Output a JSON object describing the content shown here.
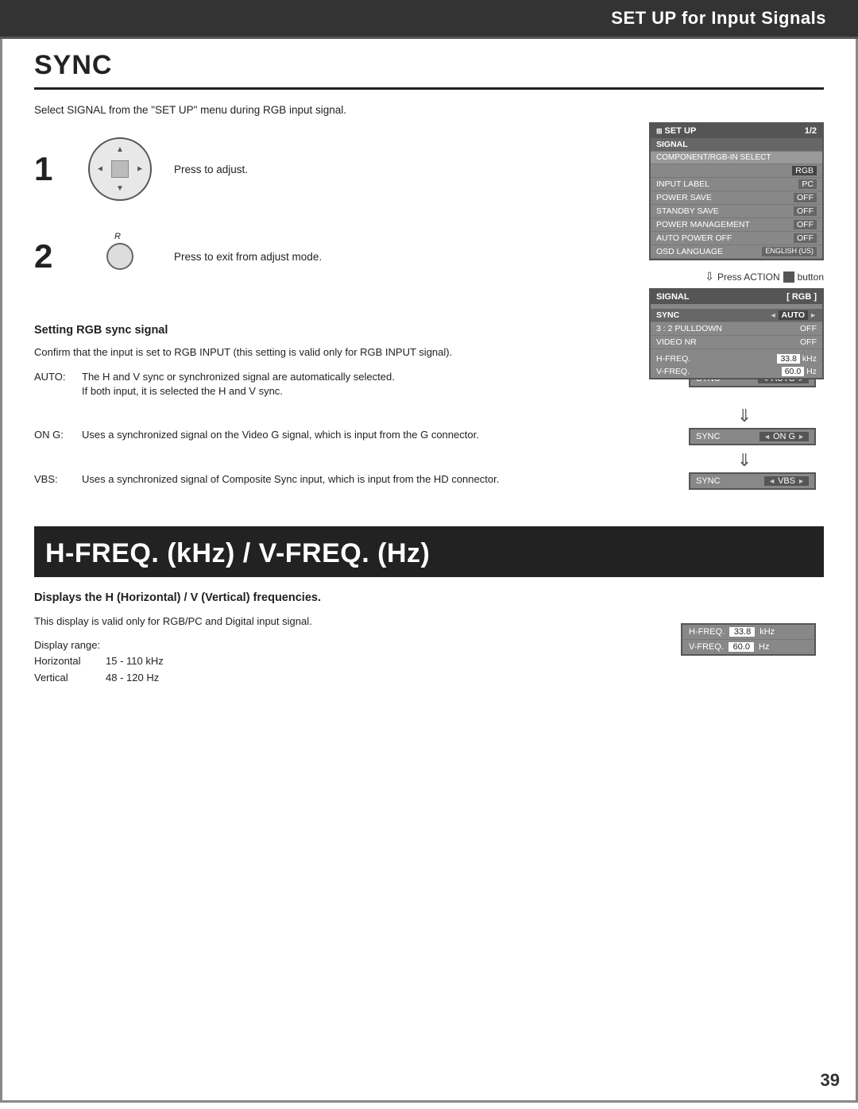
{
  "header": {
    "title": "SET UP for Input Signals"
  },
  "sync_section": {
    "title": "SYNC",
    "intro": "Select SIGNAL from the \"SET UP\" menu during RGB input signal.",
    "step1": {
      "number": "1",
      "text": "Press to adjust."
    },
    "step2": {
      "number": "2",
      "label": "R",
      "text": "Press to exit from adjust mode."
    },
    "press_action": "Press ACTION",
    "button_symbol": "■",
    "button_word": "button",
    "osd_setup": {
      "header_left": "SET UP",
      "header_right": "1/2",
      "rows": [
        {
          "label": "SIGNAL",
          "value": ""
        },
        {
          "label": "COMPONENT/RGB-IN SELECT",
          "value": ""
        },
        {
          "label": "",
          "value": "RGB"
        },
        {
          "label": "INPUT LABEL",
          "value": "PC"
        },
        {
          "label": "POWER SAVE",
          "value": "OFF"
        },
        {
          "label": "STANDBY SAVE",
          "value": "OFF"
        },
        {
          "label": "POWER MANAGEMENT",
          "value": "OFF"
        },
        {
          "label": "AUTO POWER OFF",
          "value": "OFF"
        },
        {
          "label": "OSD LANGUAGE",
          "value": "ENGLISH (US)"
        }
      ]
    },
    "osd_signal": {
      "header_left": "SIGNAL",
      "header_right": "[ RGB ]",
      "rows": [
        {
          "label": "SYNC",
          "value": "AUTO",
          "arrows": true
        },
        {
          "label": "3 : 2 PULLDOWN",
          "value": "OFF"
        },
        {
          "label": "VIDEO NR",
          "value": "OFF"
        }
      ],
      "freq_rows": [
        {
          "label": "H-FREQ.",
          "value": "33.8",
          "unit": "kHz"
        },
        {
          "label": "V-FREQ.",
          "value": "60.0",
          "unit": "Hz"
        }
      ]
    },
    "rgb_sync_subtitle": "Setting RGB sync signal",
    "rgb_sync_intro": "Confirm that the input is set to RGB INPUT (this setting is valid only for RGB INPUT signal).",
    "definitions": [
      {
        "term": "AUTO:",
        "desc": "The H and V sync or synchronized signal are automatically selected. If both input, it is selected the H and V sync."
      },
      {
        "term": "ON G:",
        "desc": "Uses a synchronized signal on the Video G signal, which is input from the G connector."
      },
      {
        "term": "VBS:",
        "desc": "Uses a synchronized signal of Composite Sync input, which is input from the HD connector."
      }
    ],
    "sync_panels": [
      {
        "label": "SYNC",
        "value": "AUTO"
      },
      {
        "label": "SYNC",
        "value": "ON G"
      },
      {
        "label": "SYNC",
        "value": "VBS"
      }
    ]
  },
  "hfreq_section": {
    "title": "H-FREQ. (kHz) / V-FREQ. (Hz)",
    "subtitle": "Displays the H (Horizontal) / V (Vertical) frequencies.",
    "text1": "This display is valid only for RGB/PC and Digital input signal.",
    "text2": "Display range:",
    "ranges": [
      {
        "label": "Horizontal",
        "value": "15 - 110 kHz"
      },
      {
        "label": "Vertical",
        "value": "48 - 120 Hz"
      }
    ],
    "freq_panel": [
      {
        "label": "H-FREQ.",
        "value": "33.8",
        "unit": "kHz"
      },
      {
        "label": "V-FREQ.",
        "value": "60.0",
        "unit": "Hz"
      }
    ]
  },
  "page_number": "39"
}
